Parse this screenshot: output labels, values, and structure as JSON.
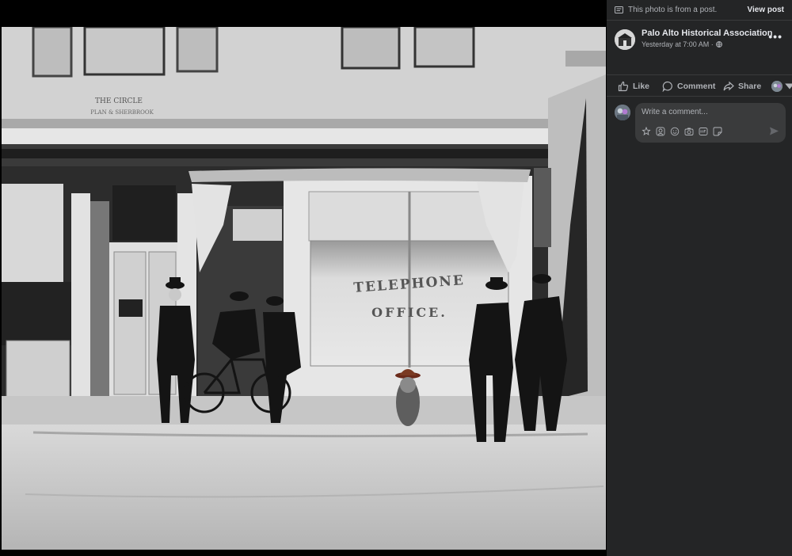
{
  "photo": {
    "sign_top": "THE CIRCLE",
    "sign_bottom": "PLAN & SHERBROOK",
    "window_line1": "TELEPHONE",
    "window_line2": "OFFICE."
  },
  "panel": {
    "notice_text": "This photo is from a post.",
    "view_post": "View post",
    "author": "Palo Alto Historical Association",
    "time": "Yesterday at 7:00 AM ·",
    "more": "•••",
    "actions": {
      "like": "Like",
      "comment": "Comment",
      "share": "Share"
    },
    "comment_placeholder": "Write a comment..."
  },
  "icons": [
    "post-icon",
    "globe-icon",
    "like-icon",
    "comment-icon",
    "share-icon",
    "avatar-icon",
    "sticker-icon",
    "gif-icon",
    "emoji-icon",
    "camera-icon",
    "send-icon"
  ],
  "colors": {
    "panel_bg": "#242526",
    "input_bg": "#3a3b3c",
    "text": "#e4e6eb",
    "muted": "#b0b3b8"
  }
}
